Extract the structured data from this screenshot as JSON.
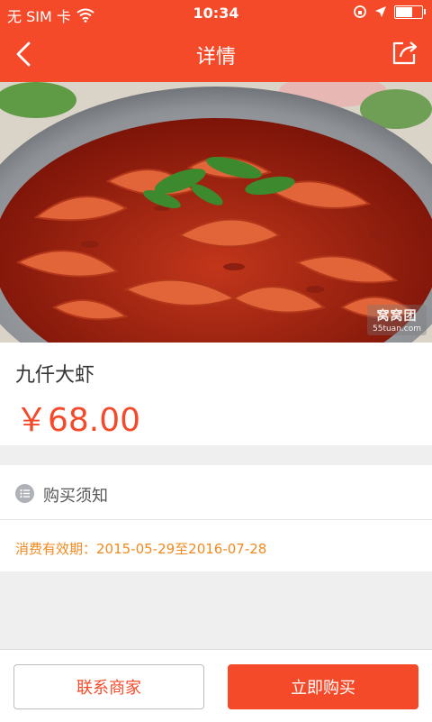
{
  "status_bar": {
    "carrier": "无 SIM 卡",
    "time": "10:34",
    "battery_level": 0.7
  },
  "nav": {
    "title": "详情",
    "back_icon": "chevron-left-icon",
    "share_icon": "share-icon"
  },
  "product": {
    "image": "boiled-crayfish-photo",
    "watermark": {
      "main": "窝窝团",
      "sub": "55tuan.com"
    },
    "name": "九仟大虾",
    "price": "￥68.00"
  },
  "notice": {
    "title": "购买须知",
    "validity": "消费有效期：2015-05-29至2016-07-28"
  },
  "actions": {
    "contact": "联系商家",
    "buy": "立即购买"
  },
  "colors": {
    "accent": "#f54a2a",
    "validity_text": "#f08a1e"
  }
}
